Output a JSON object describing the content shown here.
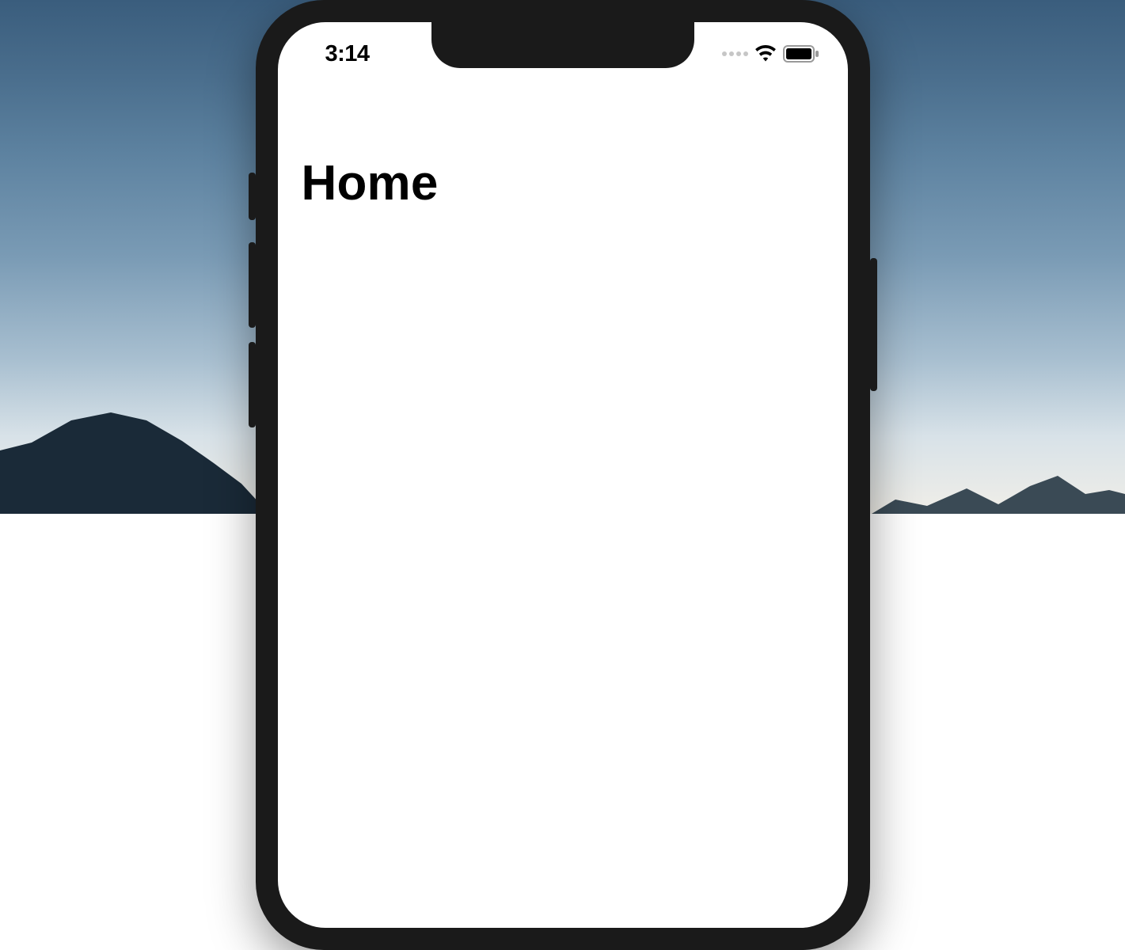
{
  "statusBar": {
    "time": "3:14"
  },
  "page": {
    "title": "Home"
  }
}
